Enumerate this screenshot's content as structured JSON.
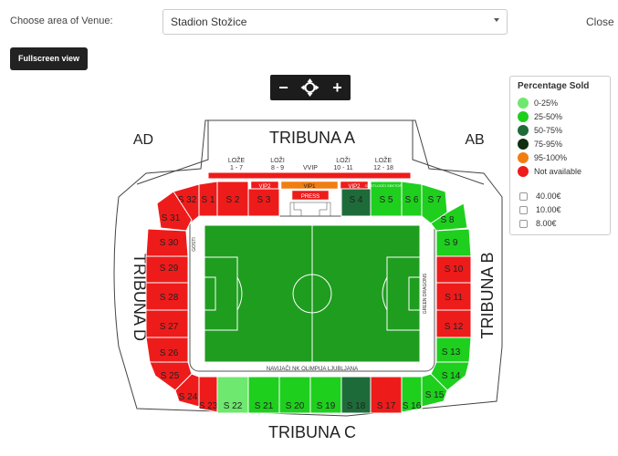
{
  "header": {
    "venue_label": "Choose area of Venue:",
    "venue_selected": "Stadion Stožice",
    "close_label": "Close",
    "fullscreen_label": "Fullscreen view"
  },
  "zoom": {
    "out_label": "−",
    "reset_icon": "crosshair-icon",
    "in_label": "+"
  },
  "legend": {
    "title": "Percentage Sold",
    "items": [
      {
        "label": "0-25%",
        "color": "#6ee86e"
      },
      {
        "label": "25-50%",
        "color": "#1ecf1e"
      },
      {
        "label": "50-75%",
        "color": "#1e6b3a"
      },
      {
        "label": "75-95%",
        "color": "#0f2e12"
      },
      {
        "label": "95-100%",
        "color": "#f07d12"
      },
      {
        "label": "Not available",
        "color": "#ee1b1b"
      }
    ],
    "prices": [
      "40.00€",
      "10.00€",
      "8.00€"
    ]
  },
  "stadium": {
    "stands": {
      "a": "TRIBUNA A",
      "b": "TRIBUNA B",
      "c": "TRIBUNA C",
      "d": "TRIBUNA D",
      "ad": "AD",
      "ab": "AB"
    },
    "boxes": [
      {
        "line1": "LOŽE",
        "line2": "1 - 7"
      },
      {
        "line1": "LOŽI",
        "line2": "8 - 9"
      },
      {
        "line1": "VVIP",
        "line2": ""
      },
      {
        "line1": "LOŽI",
        "line2": "10 - 11"
      },
      {
        "line1": "LOŽE",
        "line2": "12 - 18"
      }
    ],
    "vip_labels": [
      "VIP1",
      "VIP2",
      "VIP1",
      "VIP2"
    ],
    "press": "PRESS",
    "small_labels": {
      "gosti": "GOSTI",
      "green_dragons": "GREEN DRAGONS",
      "navijaci": "NAVIJAČI NK OLIMPIJA LJUBLJANA",
      "gost_top": "GOSTUJOČI SEKTOR"
    },
    "sectors": {
      "s1": "S 1",
      "s2": "S 2",
      "s3": "S 3",
      "s4": "S 4",
      "s5": "S 5",
      "s6": "S 6",
      "s7": "S 7",
      "s8": "S 8",
      "s9": "S 9",
      "s10": "S 10",
      "s11": "S 11",
      "s12": "S 12",
      "s13": "S 13",
      "s14": "S 14",
      "s15": "S 15",
      "s16": "S 16",
      "s17": "S 17",
      "s18": "S 18",
      "s19": "S 19",
      "s20": "S 20",
      "s21": "S 21",
      "s22": "S 22",
      "s23": "S 23",
      "s24": "S 24",
      "s25": "S 25",
      "s26": "S 26",
      "s27": "S 27",
      "s28": "S 28",
      "s29": "S 29",
      "s30": "S 30",
      "s31": "S 31",
      "s32": "S 32"
    }
  }
}
